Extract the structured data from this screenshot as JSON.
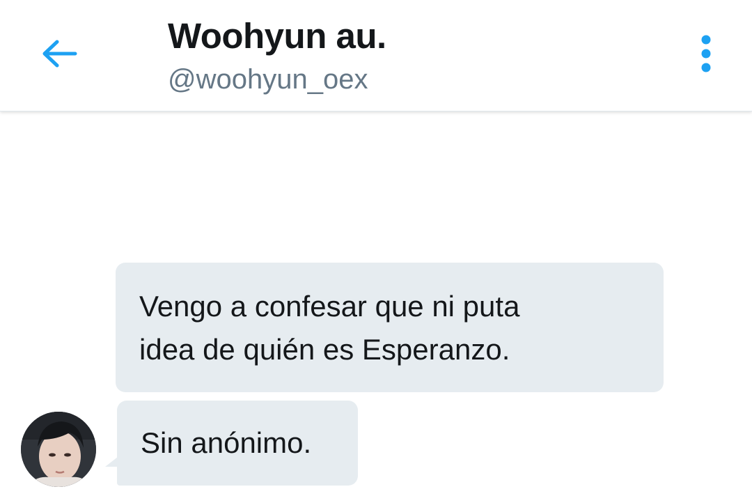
{
  "header": {
    "title": "Woohyun au.",
    "handle": "@woohyun_oex",
    "back_icon": "arrow-left-icon",
    "menu_icon": "more-vertical-icon",
    "accent_color": "#1da1f2"
  },
  "messages": [
    {
      "text_line1": "Vengo a confesar que ni puta",
      "text_line2": "idea de quién es Esperanzo."
    },
    {
      "text": "Sin anónimo."
    }
  ],
  "colors": {
    "bubble_bg": "#e6ecf0",
    "title": "#14171a",
    "handle": "#657786"
  }
}
